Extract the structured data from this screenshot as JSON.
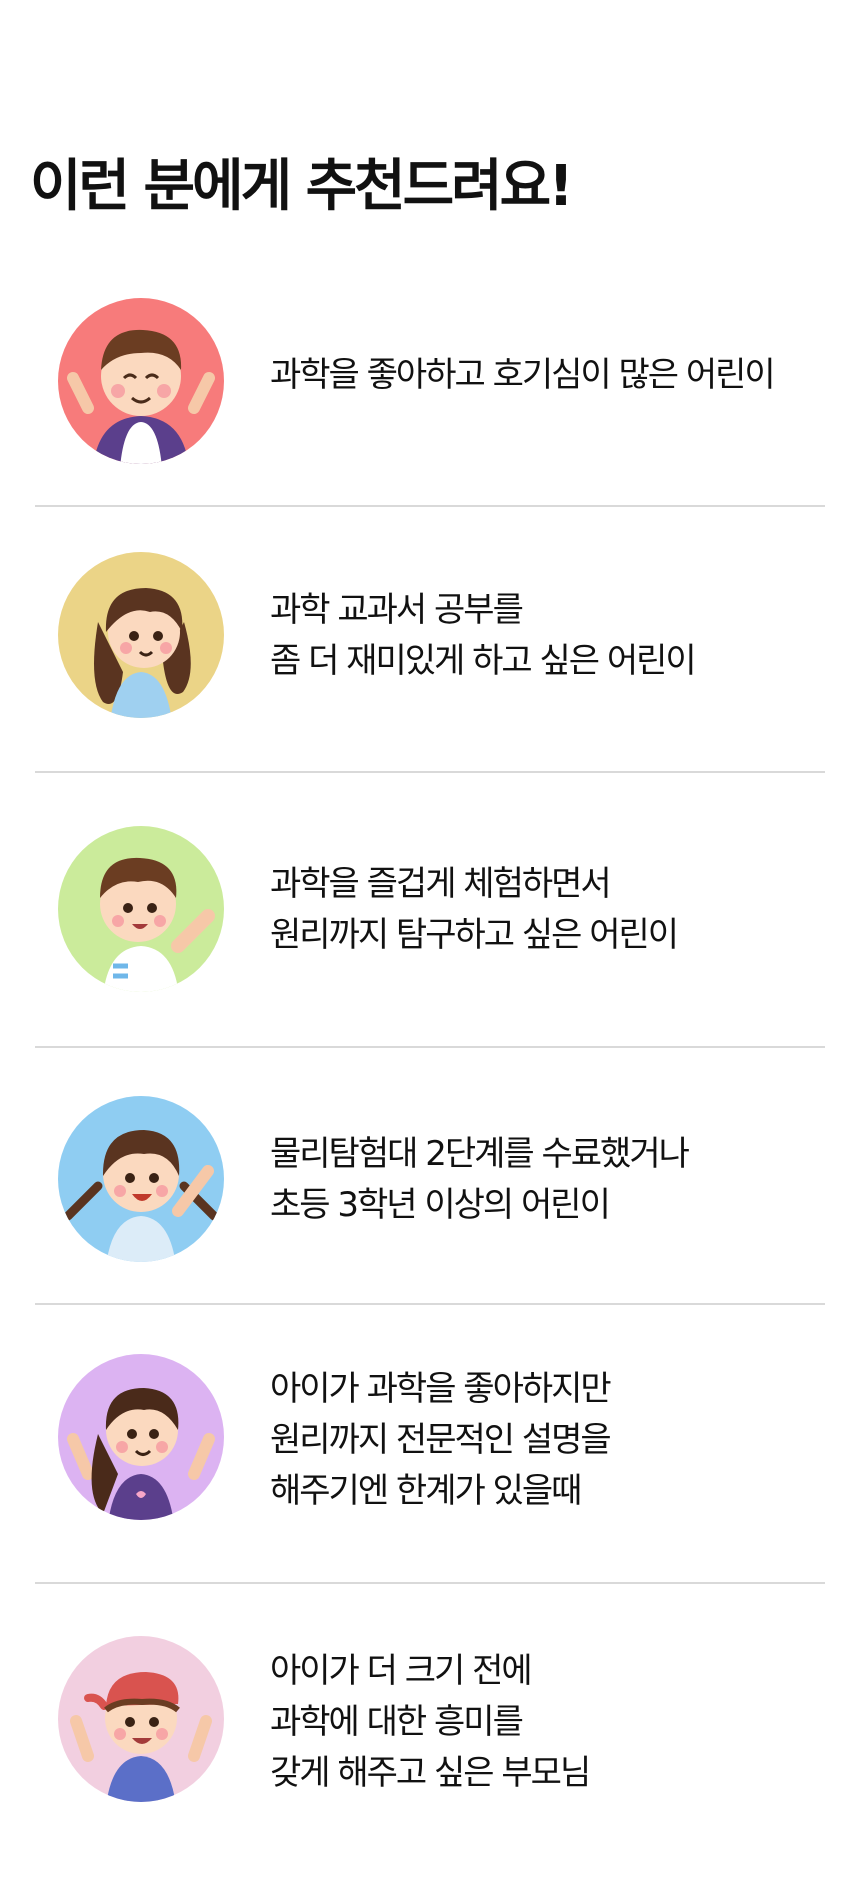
{
  "heading": "이런 분에게 추천드려요!",
  "items": [
    {
      "lines": [
        "과학을 좋아하고 호기심이 많은 어린이"
      ],
      "bg": "#f77b7b"
    },
    {
      "lines": [
        "과학 교과서 공부를",
        "좀 더 재미있게 하고 싶은 어린이"
      ],
      "bg": "#ebd487"
    },
    {
      "lines": [
        "과학을 즐겁게 체험하면서",
        "원리까지 탐구하고 싶은 어린이"
      ],
      "bg": "#cbeb9b"
    },
    {
      "lines": [
        "물리탐험대 2단계를 수료했거나",
        "초등 3학년 이상의 어린이"
      ],
      "bg": "#8fcdf2"
    },
    {
      "lines": [
        "아이가 과학을 좋아하지만",
        "원리까지 전문적인 설명을",
        "해주기엔 한계가 있을때"
      ],
      "bg": "#dcb3f2"
    },
    {
      "lines": [
        "아이가 더 크기 전에",
        "과학에 대한 흥미를",
        "갖게 해주고 싶은 부모님"
      ],
      "bg": "#f2cfe0"
    }
  ]
}
